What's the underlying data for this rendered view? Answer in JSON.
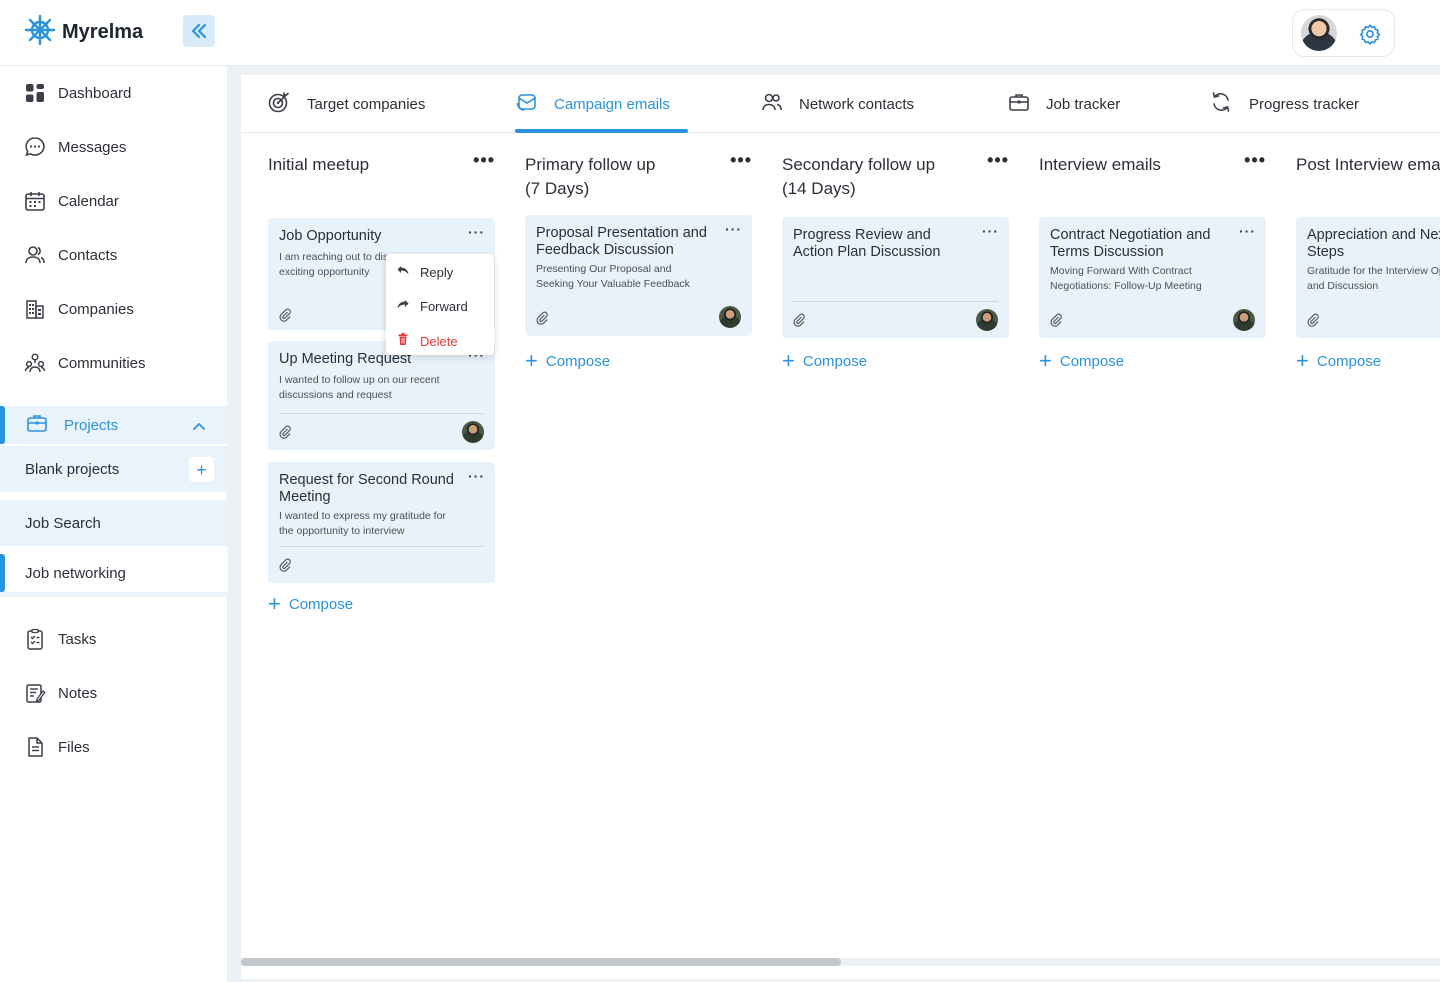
{
  "app": {
    "name": "Myrelma"
  },
  "sidebar": {
    "items": [
      {
        "label": "Dashboard",
        "icon": "dashboard-icon"
      },
      {
        "label": "Messages",
        "icon": "messages-icon"
      },
      {
        "label": "Calendar",
        "icon": "calendar-icon"
      },
      {
        "label": "Contacts",
        "icon": "contacts-icon"
      },
      {
        "label": "Companies",
        "icon": "companies-icon"
      },
      {
        "label": "Communities",
        "icon": "communities-icon"
      }
    ],
    "projects": {
      "label": "Projects",
      "sub_items": [
        {
          "label": "Blank projects"
        },
        {
          "label": "Job Search"
        },
        {
          "label": "Job networking"
        }
      ]
    },
    "bottom_items": [
      {
        "label": "Tasks",
        "icon": "tasks-icon"
      },
      {
        "label": "Notes",
        "icon": "notes-icon"
      },
      {
        "label": "Files",
        "icon": "files-icon"
      }
    ]
  },
  "tabs": [
    {
      "label": "Target companies"
    },
    {
      "label": "Campaign emails"
    },
    {
      "label": "Network contacts"
    },
    {
      "label": "Job tracker"
    },
    {
      "label": "Progress tracker"
    }
  ],
  "columns": [
    {
      "title": "Initial meetup",
      "cards": [
        {
          "title": "Job Opportunity",
          "body": "I am reaching out to discuss the exciting opportunity"
        },
        {
          "title": "Up Meeting Request",
          "body": "I wanted to follow up on our recent discussions and request"
        },
        {
          "title": "Request for Second Round Meeting",
          "body": "I wanted to express my gratitude for the opportunity to interview"
        }
      ],
      "compose": "Compose"
    },
    {
      "title": "Primary follow up\n(7 Days)",
      "cards": [
        {
          "title": "Proposal Presentation and Feedback Discussion",
          "body": "Presenting Our Proposal and Seeking Your Valuable Feedback"
        }
      ],
      "compose": "Compose"
    },
    {
      "title": "Secondary follow up\n(14 Days)",
      "cards": [
        {
          "title": "Progress Review and Action Plan Discussion",
          "body": ""
        }
      ],
      "compose": "Compose"
    },
    {
      "title": "Interview emails",
      "cards": [
        {
          "title": "Contract Negotiation and Terms Discussion",
          "body": "Moving Forward With Contract Negotiations: Follow-Up Meeting"
        }
      ],
      "compose": "Compose"
    },
    {
      "title": "Post Interview emails",
      "cards": [
        {
          "title": "Appreciation and Next Steps",
          "body": "Gratitude for the Interview Opportunity and Discussion"
        }
      ],
      "compose": "Compose"
    }
  ],
  "context_menu": {
    "items": [
      {
        "label": "Reply"
      },
      {
        "label": "Forward"
      },
      {
        "label": "Delete"
      }
    ]
  },
  "colors": {
    "accent": "#2b93d9",
    "card": "#e8f2fb",
    "danger": "#e03b3b"
  }
}
